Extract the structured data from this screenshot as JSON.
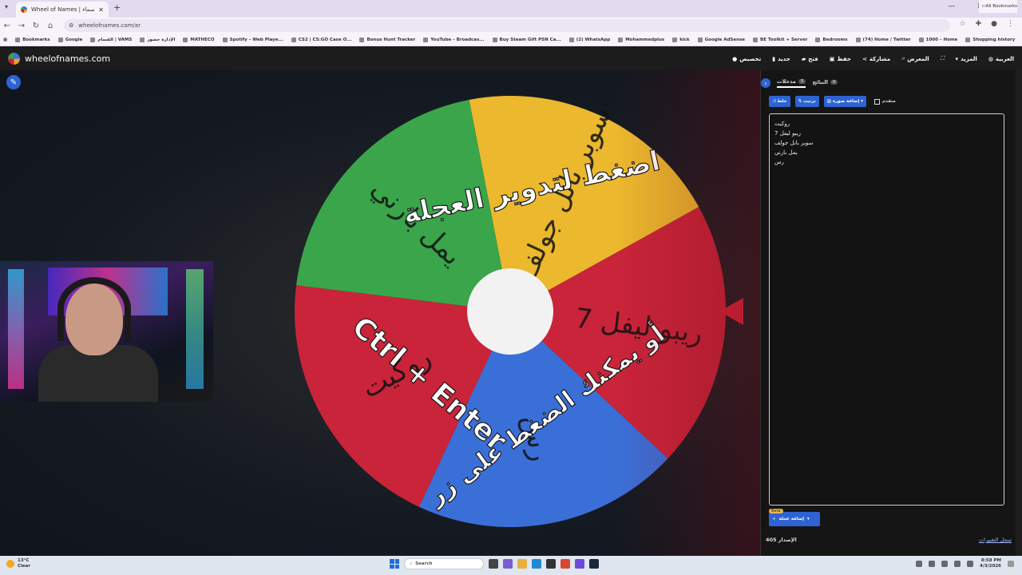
{
  "browser": {
    "tab_title": "Wheel of Names | عجلة الأسماء",
    "tab_close": "✕",
    "new_tab": "+",
    "url": "wheelofnames.com/ar",
    "bookmarks": [
      "Bookmarks",
      "Google",
      "القسام | VAMS",
      "الإدارة حضور",
      "MATHECO",
      "Spotify – Web Playe...",
      "CS2 | CS:GO Case O...",
      "Bonus Hunt Tracker",
      "YouTube – Broadcas...",
      "Buy Steam Gift PSN Ca...",
      "(2) WhatsApp",
      "Mohammedplus",
      "kick",
      "Google AdSense",
      "BE Toolkit + Server",
      "Bedrooms",
      "(74) Home / Twitter",
      "1000 – Home",
      "Shopping history"
    ],
    "all_bookmarks": "All Bookmarks"
  },
  "site": {
    "logo_text": "wheelofnames.com",
    "menu": {
      "customize": "تخصيص",
      "new": "جديد",
      "open": "فتح",
      "save": "حفظ",
      "share": "مشاركة",
      "gallery": "المعرض",
      "more": "المزيد",
      "language": "العربية"
    }
  },
  "wheel": {
    "slices": [
      {
        "label": "سوبر بانل جولف",
        "color": "#ebb82e"
      },
      {
        "label": "ريبو ليفل 7",
        "color": "#c9243a"
      },
      {
        "label": "رس",
        "color": "#3b6fd8"
      },
      {
        "label": "روكيت",
        "color": "#c9243a"
      },
      {
        "label": "يمل بارني",
        "color": "#3aa54a"
      }
    ],
    "instruction_1": "اضغط لتدوير العجلة",
    "instruction_2": "أو يمكنك الضغط على زر",
    "instruction_3": "Ctrl + Enter"
  },
  "panel": {
    "tab_entries": "مدخلات",
    "tab_entries_count": "5",
    "tab_results": "النتائج",
    "tab_results_count": "0",
    "shuffle": "خلط",
    "sort": "ترتيب",
    "add_image": "إضافة صورة",
    "advanced": "متقدم",
    "entries": [
      "روكيت",
      "ريبو ليفل 7",
      "سوبر بانل جولف",
      "يمل بارني",
      "رس"
    ],
    "beta": "Beta",
    "add_wheel": "إضافة عجلة",
    "version_label": "الإصدار",
    "version": "405",
    "changelog": "سجل التغييرات"
  },
  "taskbar": {
    "temp": "13°C",
    "weather": "Clear",
    "search": "Search",
    "time": "8:58 PM",
    "date": "4/3/2026"
  }
}
